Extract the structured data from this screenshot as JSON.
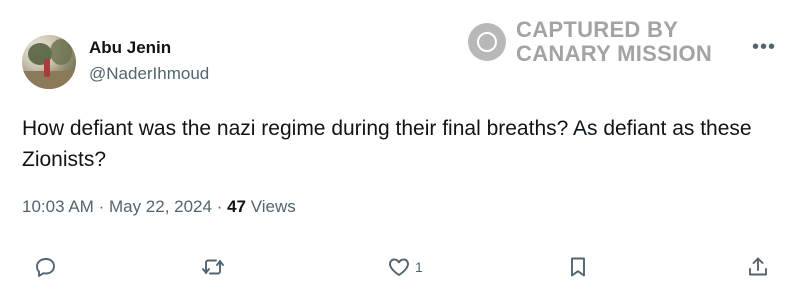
{
  "tweet": {
    "author_name": "Abu Jenin",
    "author_handle": "@NaderIhmoud",
    "text": "How defiant was the nazi regime during their final breaths? As defiant as these Zionists?",
    "time": "10:03 AM",
    "date": "May 22, 2024",
    "views_count": "47",
    "views_label": "Views"
  },
  "watermark": {
    "line1": "CAPTURED BY",
    "line2": "CANARY MISSION"
  },
  "actions": {
    "like_count": "1"
  },
  "icons": {
    "more": "more-horizontal-icon",
    "reply": "reply-icon",
    "retweet": "retweet-icon",
    "like": "heart-icon",
    "bookmark": "bookmark-icon",
    "share": "share-icon"
  },
  "colors": {
    "text": "#0f1419",
    "secondary": "#536471",
    "watermark": "#a3a3a3"
  }
}
